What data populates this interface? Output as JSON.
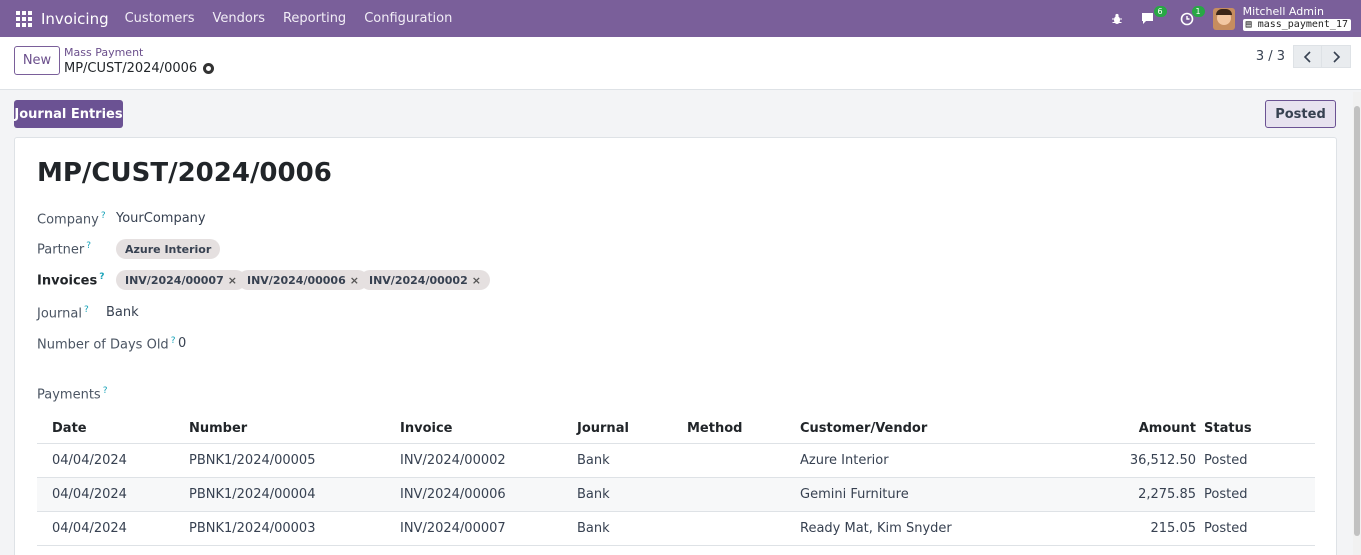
{
  "navbar": {
    "app_name": "Invoicing",
    "menus": [
      "Customers",
      "Vendors",
      "Reporting",
      "Configuration"
    ],
    "chat_badge": "6",
    "activity_badge": "1",
    "user_name": "Mitchell Admin",
    "db_name": "mass_payment_17"
  },
  "control": {
    "new_label": "New",
    "breadcrumb_parent": "Mass Payment",
    "breadcrumb_current": "MP/CUST/2024/0006",
    "pager": "3 / 3"
  },
  "statusbar": {
    "journal_entries_label": "Journal Entries",
    "state_label": "Posted"
  },
  "form": {
    "title": "MP/CUST/2024/0006",
    "company_label": "Company",
    "company_value": "YourCompany",
    "partner_label": "Partner",
    "partner_value": "Azure Interior",
    "invoices_label": "Invoices",
    "invoices": [
      "INV/2024/00007",
      "INV/2024/00006",
      "INV/2024/00002"
    ],
    "journal_label": "Journal",
    "journal_value": "Bank",
    "days_old_label": "Number of Days Old",
    "days_old_value": "0",
    "payments_label": "Payments",
    "help_mark": "?"
  },
  "payments_table": {
    "headers": {
      "date": "Date",
      "number": "Number",
      "invoice": "Invoice",
      "journal": "Journal",
      "method": "Method",
      "partner": "Customer/Vendor",
      "amount": "Amount",
      "status": "Status"
    },
    "rows": [
      {
        "date": "04/04/2024",
        "number": "PBNK1/2024/00005",
        "invoice": "INV/2024/00002",
        "journal": "Bank",
        "method": "",
        "partner": "Azure Interior",
        "amount": "36,512.50",
        "status": "Posted"
      },
      {
        "date": "04/04/2024",
        "number": "PBNK1/2024/00004",
        "invoice": "INV/2024/00006",
        "journal": "Bank",
        "method": "",
        "partner": "Gemini Furniture",
        "amount": "2,275.85",
        "status": "Posted"
      },
      {
        "date": "04/04/2024",
        "number": "PBNK1/2024/00003",
        "invoice": "INV/2024/00007",
        "journal": "Bank",
        "method": "",
        "partner": "Ready Mat, Kim Snyder",
        "amount": "215.05",
        "status": "Posted"
      }
    ]
  },
  "colors": {
    "navbar": "#7a5f9a",
    "primary": "#6b5293",
    "badge": "#28a745"
  }
}
